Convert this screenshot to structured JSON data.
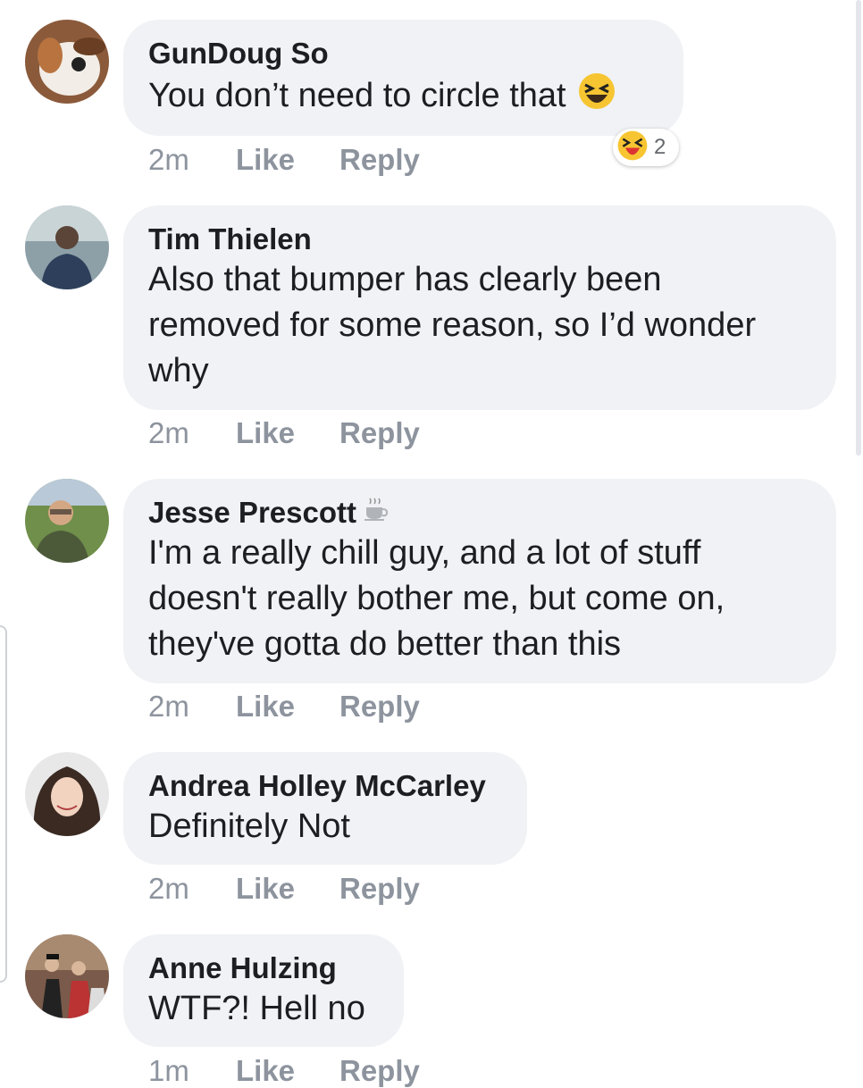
{
  "comments": [
    {
      "author": "GunDoug So",
      "text": "You don’t need to circle that",
      "time": "2m",
      "like_label": "Like",
      "reply_label": "Reply",
      "reaction": {
        "icon": "laugh-emoji",
        "count": "2"
      }
    },
    {
      "author": "Tim Thielen",
      "text": "Also that bumper has clearly been removed for some reason, so I’d wonder why",
      "lines": [
        "Also that bumper has clearly been",
        "removed for some reason, so I’d wonder",
        "why"
      ],
      "time": "2m",
      "like_label": "Like",
      "reply_label": "Reply"
    },
    {
      "author": "Jesse Prescott",
      "author_icon": "coffee-icon",
      "text": "I'm a really chill guy, and a lot of stuff doesn't really bother me, but come on, they've gotta do better than this",
      "lines": [
        "I'm a really chill guy, and a lot of stuff",
        "doesn't really bother me, but come on,",
        "they've gotta do better than this"
      ],
      "time": "2m",
      "like_label": "Like",
      "reply_label": "Reply"
    },
    {
      "author": "Andrea Holley McCarley",
      "text": "Definitely Not",
      "time": "2m",
      "like_label": "Like",
      "reply_label": "Reply"
    },
    {
      "author": "Anne Hulzing",
      "text": "WTF?! Hell no",
      "time": "1m",
      "like_label": "Like",
      "reply_label": "Reply"
    }
  ],
  "colors": {
    "bubble": "#f0f2f5",
    "meta": "#8d949e",
    "text": "#1c1e21"
  }
}
